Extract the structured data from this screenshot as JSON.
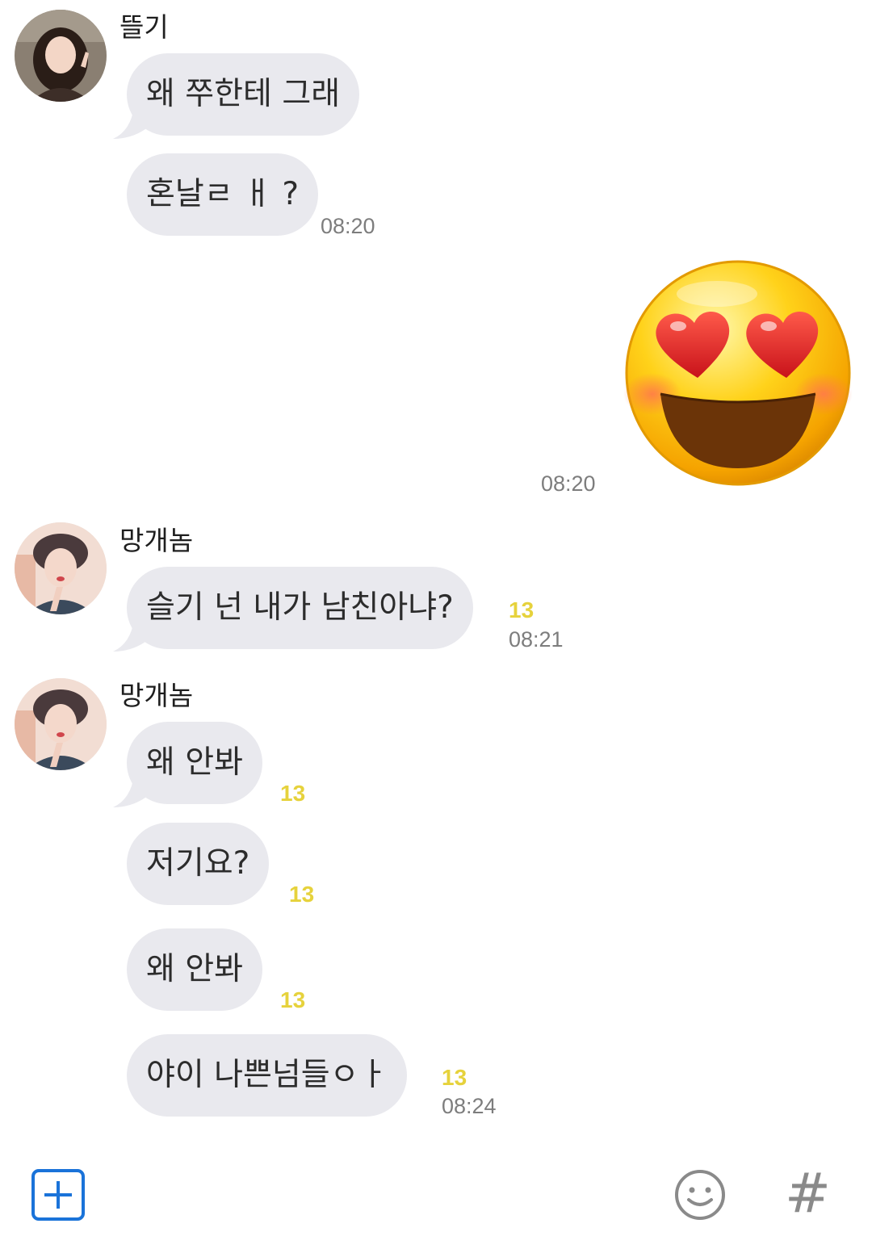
{
  "colors": {
    "bubble": "#e9e9ee",
    "unread": "#e6d23c",
    "accent": "#1a73d9",
    "timestamp": "#7d7d7d"
  },
  "groups": [
    {
      "sender": "뜰기",
      "avatar_icon": "profile-photo-icon",
      "messages": [
        {
          "text": "왜 쭈한테 그래"
        },
        {
          "text": "혼날ㄹ ㅐ ?",
          "time": "08:20"
        }
      ]
    },
    {
      "sender": "",
      "outgoing": true,
      "messages": [
        {
          "emoticon": "heart-eyes-emoji-icon",
          "time": "08:20"
        }
      ]
    },
    {
      "sender": "망개놈",
      "avatar_icon": "profile-photo-icon",
      "messages": [
        {
          "text": "슬기 넌 내가 남친아냐?",
          "unread": "13",
          "time": "08:21"
        }
      ]
    },
    {
      "sender": "망개놈",
      "avatar_icon": "profile-photo-icon",
      "messages": [
        {
          "text": "왜 안봐",
          "unread": "13"
        },
        {
          "text": "저기요?",
          "unread": "13"
        },
        {
          "text": "왜 안봐",
          "unread": "13"
        },
        {
          "text": "야이 나쁜넘들ㅇㅏ",
          "unread": "13",
          "time": "08:24"
        }
      ]
    }
  ],
  "toolbar": {
    "add_icon": "plus-square-icon",
    "emoji_icon": "smiley-icon",
    "hashtag_icon": "hashtag-icon",
    "hashtag_glyph": "#"
  }
}
